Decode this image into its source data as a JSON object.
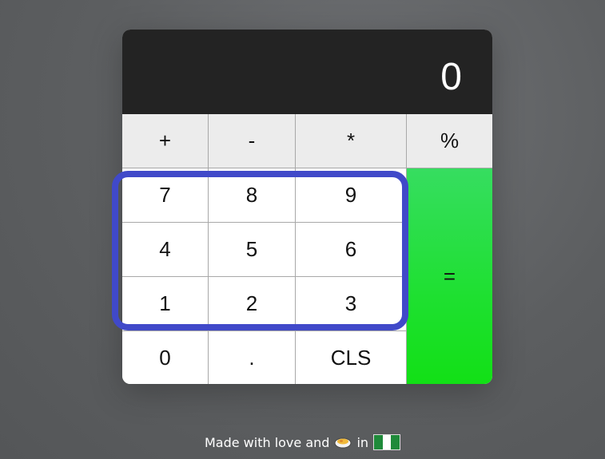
{
  "display": {
    "value": "0"
  },
  "operators": [
    "+",
    "-",
    "*",
    "%"
  ],
  "digits": {
    "row1": [
      "7",
      "8",
      "9"
    ],
    "row2": [
      "4",
      "5",
      "6"
    ],
    "row3": [
      "1",
      "2",
      "3"
    ],
    "row4": [
      "0",
      ".",
      "CLS"
    ]
  },
  "equals_label": "=",
  "footer": {
    "text_before": "Made with love and",
    "text_in": "in",
    "food_icon": "food-bowl-icon",
    "flag_icon": "nigeria-flag-icon"
  },
  "colors": {
    "display_bg": "#232323",
    "operator_bg": "#ececec",
    "equals_green": "#1ee030",
    "highlight": "#4049c9"
  }
}
